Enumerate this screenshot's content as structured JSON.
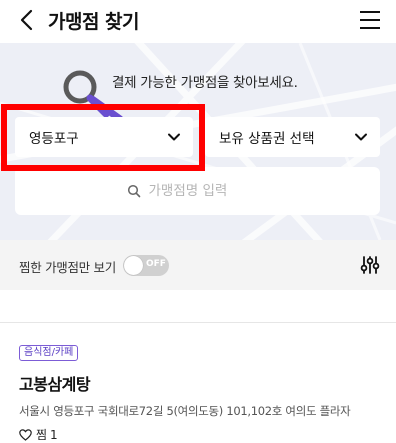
{
  "header": {
    "title": "가맹점 찾기"
  },
  "hero": {
    "message": "결제 가능한 가맹점을 찾아보세요."
  },
  "filters": {
    "district_selected": "영등포구",
    "voucher_selected": "보유 상품권 선택",
    "search_placeholder": "가맹점명 입력"
  },
  "filter_bar": {
    "liked_only_label": "찜한 가맹점만 보기",
    "toggle_state": "OFF"
  },
  "stores": [
    {
      "category": "음식점/카페",
      "name": "고봉삼계탕",
      "address": "서울시 영등포구 국회대로72길 5(여의도동) 101,102호 여의도 플라자",
      "like_label": "찜",
      "like_count": "1"
    }
  ],
  "colors": {
    "hero_bg": "#edeff6",
    "accent_purple": "#6a4fd0",
    "highlight_red": "#ff0000"
  }
}
